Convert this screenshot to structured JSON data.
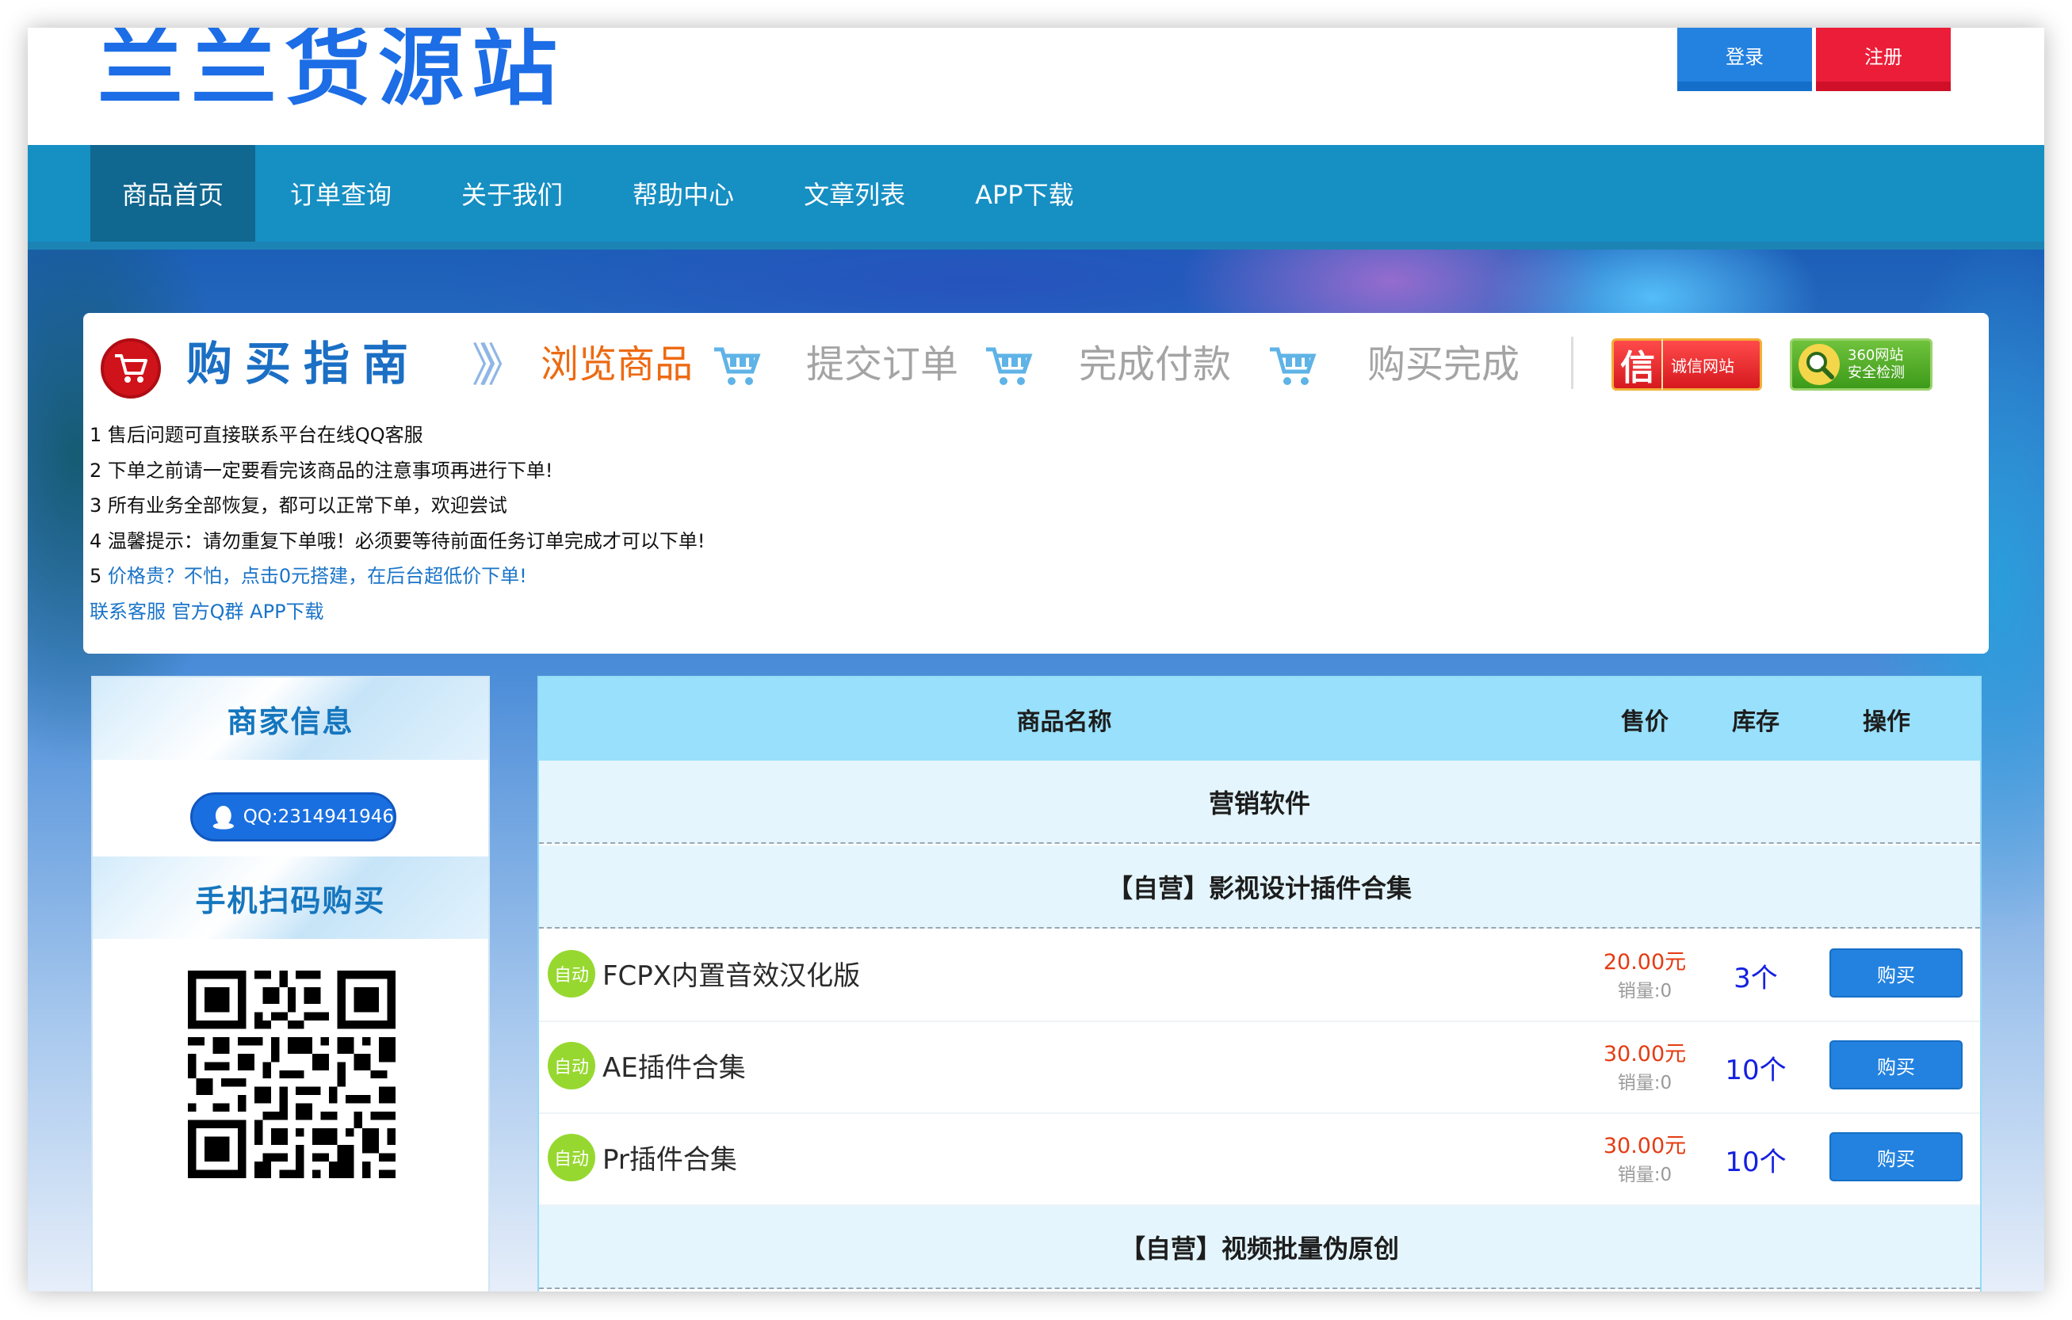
{
  "header": {
    "logo": "兰兰货源站",
    "login_label": "登录",
    "register_label": "注册"
  },
  "nav": {
    "items": [
      "商品首页",
      "订单查询",
      "关于我们",
      "帮助中心",
      "文章列表",
      "APP下载"
    ]
  },
  "guide": {
    "title": "购买指南",
    "arrows": "》》",
    "steps": [
      "浏览商品",
      "提交订单",
      "完成付款",
      "购买完成"
    ],
    "trust_badge": {
      "big": "信",
      "text": "诚信网站"
    },
    "safety_badge": {
      "line1": "360网站",
      "line2": "安全检测"
    },
    "notices": [
      "1 售后问题可直接联系平台在线QQ客服",
      "2 下单之前请一定要看完该商品的注意事项再进行下单!",
      "3 所有业务全部恢复，都可以正常下单，欢迎尝试",
      "4 温馨提示：请勿重复下单哦！必须要等待前面任务订单完成才可以下单!"
    ],
    "notice_5_prefix": "5 ",
    "notice_5_link": "价格贵？不怕，点击0元搭建，在后台超低价下单!",
    "contact_links": [
      "联系客服",
      "官方Q群",
      "APP下载"
    ]
  },
  "sidebar": {
    "merchant_title": "商家信息",
    "qq_label": "QQ:2314941946",
    "scan_title": "手机扫码购买"
  },
  "table": {
    "headers": {
      "name": "商品名称",
      "price": "售价",
      "stock": "库存",
      "op": "操作"
    },
    "categories": [
      "营销软件",
      "【自营】影视设计插件合集",
      "【自营】视频批量伪原创"
    ],
    "products": [
      {
        "badge": "自动",
        "name": "FCPX内置音效汉化版",
        "price": "20.00元",
        "sales": "销量:0",
        "stock": "3个",
        "buy": "购买"
      },
      {
        "badge": "自动",
        "name": "AE插件合集",
        "price": "30.00元",
        "sales": "销量:0",
        "stock": "10个",
        "buy": "购买"
      },
      {
        "badge": "自动",
        "name": "Pr插件合集",
        "price": "30.00元",
        "sales": "销量:0",
        "stock": "10个",
        "buy": "购买"
      }
    ]
  },
  "colors": {
    "brand_blue": "#1c6de6",
    "nav_bg": "#168fc3",
    "nav_active": "#10678f",
    "register_red": "#ec1d38",
    "price_red": "#e43b12",
    "table_header": "#98e0fb",
    "auto_green": "#97d830"
  },
  "icons": [
    "cart-icon",
    "cart-step-icon",
    "qq-penguin-icon",
    "magnifier-icon",
    "qr-code"
  ]
}
